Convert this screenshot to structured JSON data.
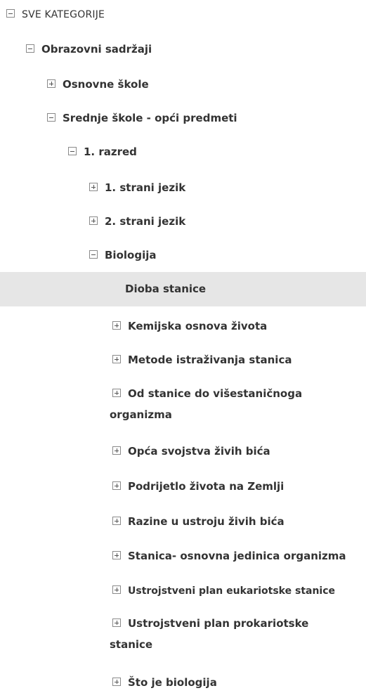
{
  "tree": {
    "root": {
      "label": "SVE KATEGORIJE",
      "toggle": "minus"
    },
    "obrazovni": {
      "label": "Obrazovni sadržaji",
      "toggle": "minus"
    },
    "osnovne": {
      "label": "Osnovne škole",
      "toggle": "plus"
    },
    "srednje": {
      "label": "Srednje škole - opći predmeti",
      "toggle": "minus"
    },
    "razred1": {
      "label": "1. razred",
      "toggle": "minus"
    },
    "strani1": {
      "label": "1. strani jezik",
      "toggle": "plus"
    },
    "strani2": {
      "label": "2. strani jezik",
      "toggle": "plus"
    },
    "biologija": {
      "label": "Biologija",
      "toggle": "minus"
    },
    "dioba": {
      "label": "Dioba stanice",
      "selected": true
    },
    "kemijska": {
      "label": "Kemijska osnova života",
      "toggle": "plus"
    },
    "metode": {
      "label": "Metode istraživanja stanica",
      "toggle": "plus"
    },
    "od_stanice": {
      "label": "Od stanice do višestaničnoga organizma",
      "toggle": "plus"
    },
    "opca": {
      "label": "Opća svojstva živih bića",
      "toggle": "plus"
    },
    "podrijetlo": {
      "label": "Podrijetlo života na Zemlji",
      "toggle": "plus"
    },
    "razine": {
      "label": "Razine u ustroju živih bića",
      "toggle": "plus"
    },
    "stanica": {
      "label": "Stanica- osnovna jedinica organizma",
      "toggle": "plus"
    },
    "euk": {
      "label": "Ustrojstveni plan eukariotske stanice",
      "toggle": "plus"
    },
    "prok": {
      "label": "Ustrojstveni plan prokariotske stanice",
      "toggle": "plus"
    },
    "sto": {
      "label": "Što je biologija",
      "toggle": "plus"
    }
  }
}
